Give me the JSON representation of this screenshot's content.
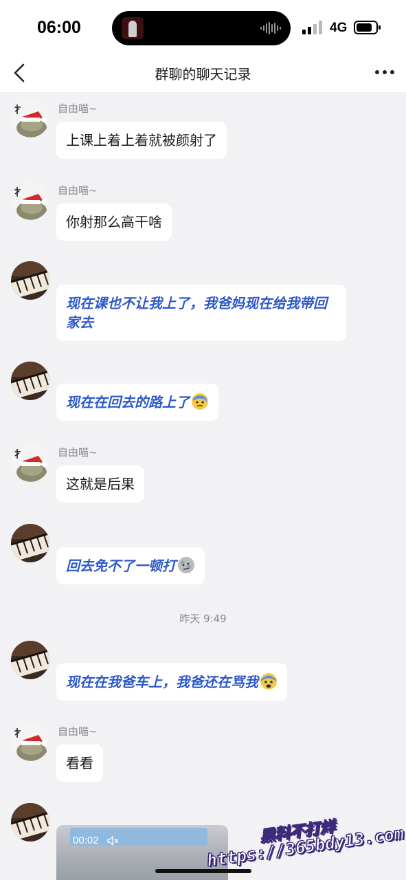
{
  "status_bar": {
    "time": "06:00",
    "network": "4G",
    "icons": [
      "now-playing-art",
      "waveform-icon",
      "signal-icon",
      "battery-icon"
    ]
  },
  "nav": {
    "title": "群聊的聊天记录",
    "back_icon": "chevron-left-icon",
    "more_icon": "more-dots-icon"
  },
  "colors": {
    "background": "#f2f2f5",
    "bubble": "#ffffff",
    "blue_text": "#2c58c9",
    "meta_text": "#8a8a8e"
  },
  "messages": [
    {
      "sender": "自由喵~",
      "avatar": "cat-santa-hat-avatar",
      "text": "上课上着上着就被颜射了"
    },
    {
      "sender": "自由喵~",
      "avatar": "cat-santa-hat-avatar",
      "text": "你射那么高干啥"
    },
    {
      "sender": "",
      "avatar": "piano-avatar",
      "text": "现在课也不让我上了，我爸妈现在给我带回家去"
    },
    {
      "sender": "",
      "avatar": "piano-avatar",
      "text": "现在在回去的路上了",
      "emoji": "anxious-sweat-emoji"
    },
    {
      "sender": "自由喵~",
      "avatar": "cat-santa-hat-avatar",
      "text": "这就是后果"
    },
    {
      "sender": "",
      "avatar": "piano-avatar",
      "text": "回去免不了一顿打",
      "emoji": "moon-face-emoji"
    },
    {
      "timestamp": "昨天 9:49"
    },
    {
      "sender": "",
      "avatar": "piano-avatar",
      "text": "现在在我爸车上，我爸还在骂我",
      "emoji": "fearful-face-emoji"
    },
    {
      "sender": "自由喵~",
      "avatar": "cat-santa-hat-avatar",
      "text": "看看"
    },
    {
      "sender": "",
      "avatar": "piano-avatar",
      "video": {
        "duration": "00:02",
        "icon": "muted-speaker-icon"
      }
    }
  ],
  "watermark": {
    "line1": "黑料不打烊",
    "line2": "https://365bdy13.com"
  }
}
